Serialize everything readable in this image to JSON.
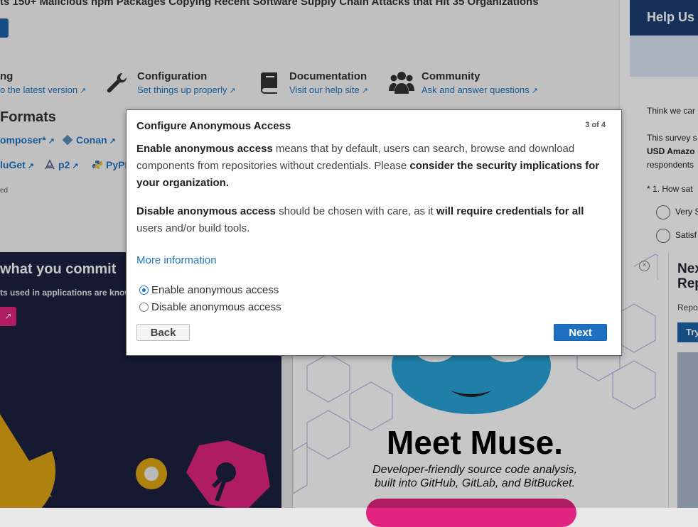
{
  "page": {
    "headline": "ts 150+ Malicious npm Packages Copying Recent Software Supply Chain Attacks that Hit 35 Organizations",
    "features": [
      {
        "title": "ng",
        "link": "o the latest version"
      },
      {
        "title": "Configuration",
        "link": "Set things up properly"
      },
      {
        "title": "Documentation",
        "link": "Visit our help site"
      },
      {
        "title": "Community",
        "link": "Ask and answer questions"
      }
    ],
    "formats_title": "Formats",
    "formats_row1": [
      "omposer*",
      "Conan"
    ],
    "formats_row2": [
      "luGet",
      "p2",
      "PyPI"
    ],
    "small_note": "ed"
  },
  "sidebar": {
    "header": "Help Us",
    "line1": "Think we car",
    "line2": "This survey s",
    "line3": "USD Amazo",
    "line4": "respondents",
    "question": "* 1. How sat",
    "option1": "Very S",
    "option2": "Satisf"
  },
  "promo": {
    "heading": "what you commit",
    "subtext": "ts used in applications are know",
    "button_icon": "external-link-icon"
  },
  "muse": {
    "title": "Meet Muse.",
    "subtitle_line1": "Developer-friendly source code analysis,",
    "subtitle_line2": "built into GitHub, GitLab, and BitBucket.",
    "close": "×"
  },
  "next_card": {
    "title_line1": "Nex",
    "title_line2": "Rep",
    "text": "Repo",
    "button": "Try"
  },
  "dialog": {
    "title": "Configure Anonymous Access",
    "step": "3 of 4",
    "enable_para": {
      "b1": "Enable anonymous access",
      "t1": " means that by default, users can search, browse and download components from repositories without credentials. Please ",
      "b2": "consider the security implications for your organization."
    },
    "disable_para": {
      "b1": "Disable anonymous access",
      "t1": " should be chosen with care, as it ",
      "b2": "will require credentials for all",
      "t2": " users and/or build tools."
    },
    "more_info": "More information",
    "options": [
      {
        "label": "Enable anonymous access",
        "selected": true
      },
      {
        "label": "Disable anonymous access",
        "selected": false
      }
    ],
    "back_label": "Back",
    "next_label": "Next"
  },
  "colors": {
    "accent": "#1e75c0",
    "primary_button": "#1d70c2",
    "sidebar_header": "#1b3f73",
    "promo_bg": "#1c2140",
    "pink": "#e0247f"
  },
  "icons": [
    "wrench-icon",
    "book-icon",
    "community-icon",
    "external-link-icon",
    "conan-icon",
    "p2-icon",
    "python-icon"
  ]
}
